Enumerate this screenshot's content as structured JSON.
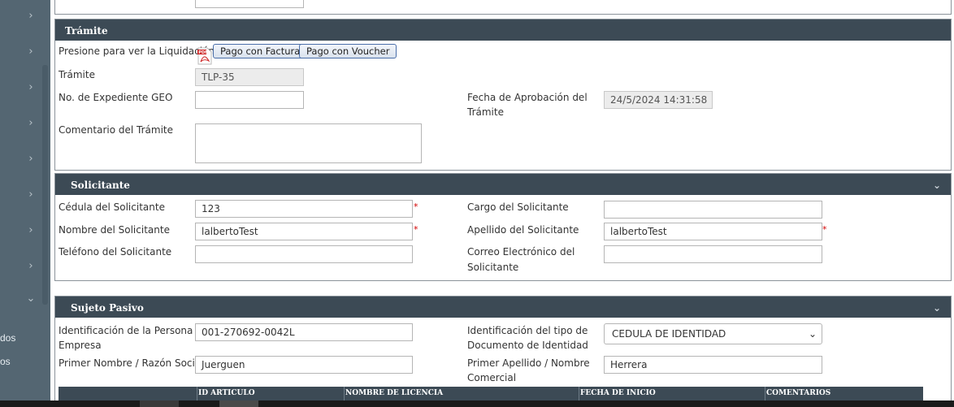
{
  "sidebar": {
    "chevron_glyph": "›",
    "expand_glyph": "⌄",
    "items": [
      {
        "label": "dos"
      },
      {
        "label": "os"
      }
    ]
  },
  "tramite": {
    "title": "Trámite",
    "liquidacion_label": "Presione para ver la Liquidación",
    "pdf_icon": "pdf-file-icon",
    "btn_factura": "Pago con Factura",
    "btn_voucher": "Pago con Voucher",
    "tramite_label": "Trámite",
    "tramite_value": "TLP-35",
    "expediente_label": "No. de Expediente GEO",
    "expediente_value": "",
    "fecha_label_1": "Fecha de Aprobación del",
    "fecha_label_2": "Trámite",
    "fecha_value": "24/5/2024 14:31:58",
    "comentario_label": "Comentario del Trámite",
    "comentario_value": ""
  },
  "solicitante": {
    "title": "Solicitante",
    "cedula_label": "Cédula del Solicitante",
    "cedula_value": "123",
    "cargo_label": "Cargo del Solicitante",
    "cargo_value": "",
    "nombre_label": "Nombre del Solicitante",
    "nombre_value": "lalbertoTest",
    "apellido_label": "Apellido del Solicitante",
    "apellido_value": "lalbertoTest",
    "telefono_label": "Teléfono del Solicitante",
    "telefono_value": "",
    "correo_label_1": "Correo Electrónico del",
    "correo_label_2": "Solicitante",
    "correo_value": "",
    "required_mark": "*"
  },
  "sujeto": {
    "title": "Sujeto Pasivo",
    "ident_label_1": "Identificación de la Persona /",
    "ident_label_2": "Empresa",
    "ident_value": "001-270692-0042L",
    "tipo_label_1": "Identificación del tipo de",
    "tipo_label_2": "Documento de Identidad",
    "tipo_value": "CEDULA DE IDENTIDAD",
    "nombre_label": "Primer Nombre / Razón Social",
    "nombre_value": "Juerguen",
    "apellido_label_1": "Primer Apellido / Nombre",
    "apellido_label_2": "Comercial",
    "apellido_value": "Herrera"
  },
  "grid": {
    "columns": [
      "ID ARTICULO",
      "NOMBRE DE LICENCIA",
      "FECHA DE INICIO",
      "COMENTARIOS"
    ]
  },
  "colors": {
    "panel_header": "#3c4a55",
    "sidebar": "#546672",
    "required": "#d40000"
  }
}
